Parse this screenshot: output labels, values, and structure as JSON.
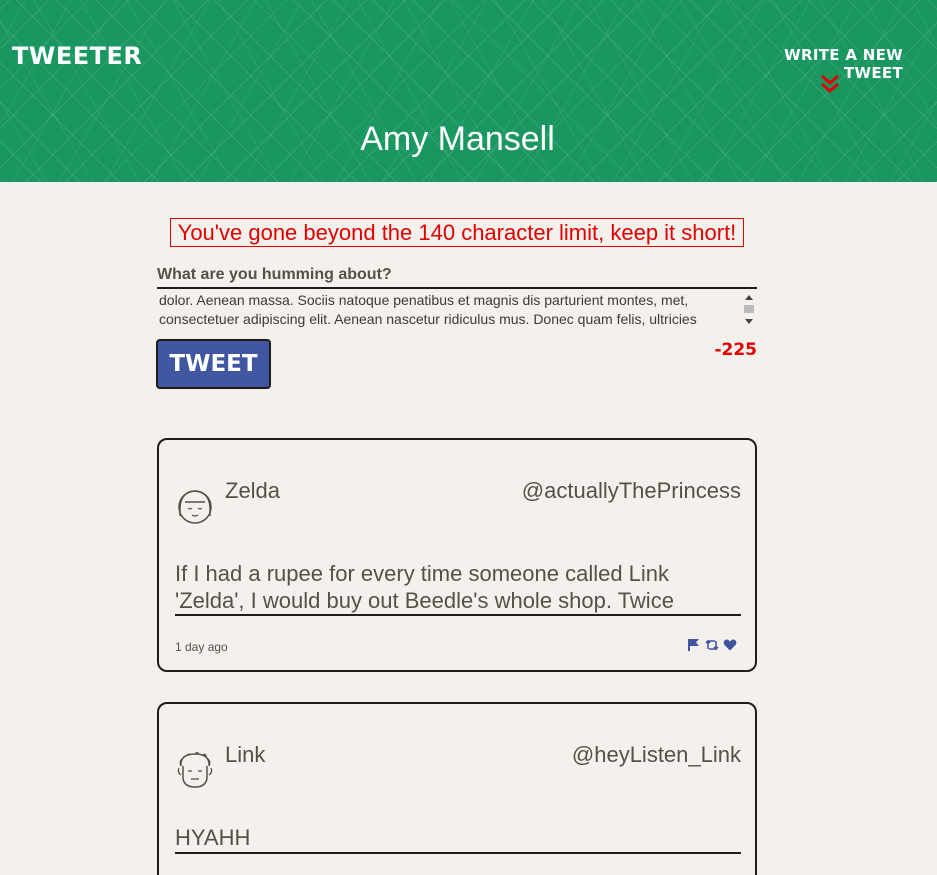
{
  "header": {
    "brand": "Tweeter",
    "compose_toggle": "Write a new tweet",
    "profile_name": "Amy Mansell",
    "colors": {
      "background": "#1a9760",
      "accent": "#e00000"
    }
  },
  "compose": {
    "error": "You've gone beyond the 140 character limit, keep it short!",
    "label": "What are you humming about?",
    "textarea_value": "dolor. Aenean massa. Sociis natoque penatibus et magnis dis parturient montes, met, consectetuer adipiscing elit. Aenean nascetur ridiculus mus. Donec quam felis, ultricies",
    "submit_label": "Tweet",
    "counter": "-225",
    "colors": {
      "button": "#4056a1",
      "error": "#e00000"
    }
  },
  "tweets": [
    {
      "name": "Zelda",
      "handle": "@actuallyThePrincess",
      "content": "If I had a rupee for every time someone called Link 'Zelda', I would buy out Beedle's whole shop. Twice",
      "timestamp": "1 day ago",
      "avatar_icon": "girl-avatar-icon",
      "action_icons": [
        "flag-icon",
        "retweet-icon",
        "heart-icon"
      ]
    },
    {
      "name": "Link",
      "handle": "@heyListen_Link",
      "content": "HYAHH",
      "avatar_icon": "boy-avatar-icon"
    }
  ]
}
